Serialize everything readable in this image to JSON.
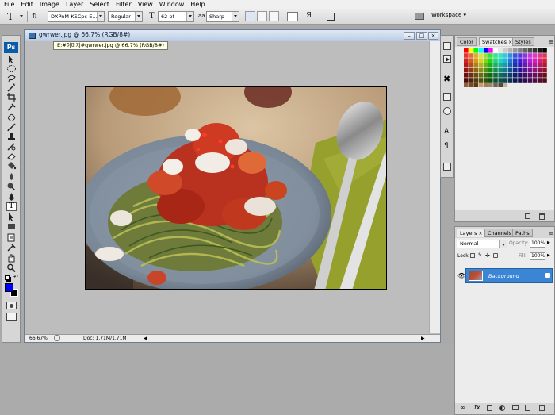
{
  "menu": [
    "File",
    "Edit",
    "Image",
    "Layer",
    "Select",
    "Filter",
    "View",
    "Window",
    "Help"
  ],
  "options": {
    "font_family": "DXPnM-KSCpc-E...",
    "font_style": "Regular",
    "font_size": "62 pt",
    "aa_label": "aa",
    "antialias": "Sharp",
    "workspace": "Workspace"
  },
  "document": {
    "title": "gwrwer.jpg @ 66.7% (RGB/8#)",
    "tooltip": "E:#이미지#gwrwer.jpg @ 66.7% (RGB/8#)",
    "zoom": "66.67%",
    "doc_info": "Doc: 1.71M/1.71M"
  },
  "swatches_panel": {
    "tabs": [
      "Color",
      "Swatches",
      "Styles"
    ],
    "active": "Swatches"
  },
  "layers_panel": {
    "tabs": [
      "Layers",
      "Channels",
      "Paths"
    ],
    "blend_mode": "Normal",
    "opacity_label": "Opacity:",
    "opacity": "100%",
    "lock_label": "Lock:",
    "fill_label": "Fill:",
    "fill": "100%",
    "layer_name": "Background"
  },
  "colors": {
    "foreground": "#0000ff",
    "background": "#000000",
    "layer_selected": "#3b85d6"
  }
}
